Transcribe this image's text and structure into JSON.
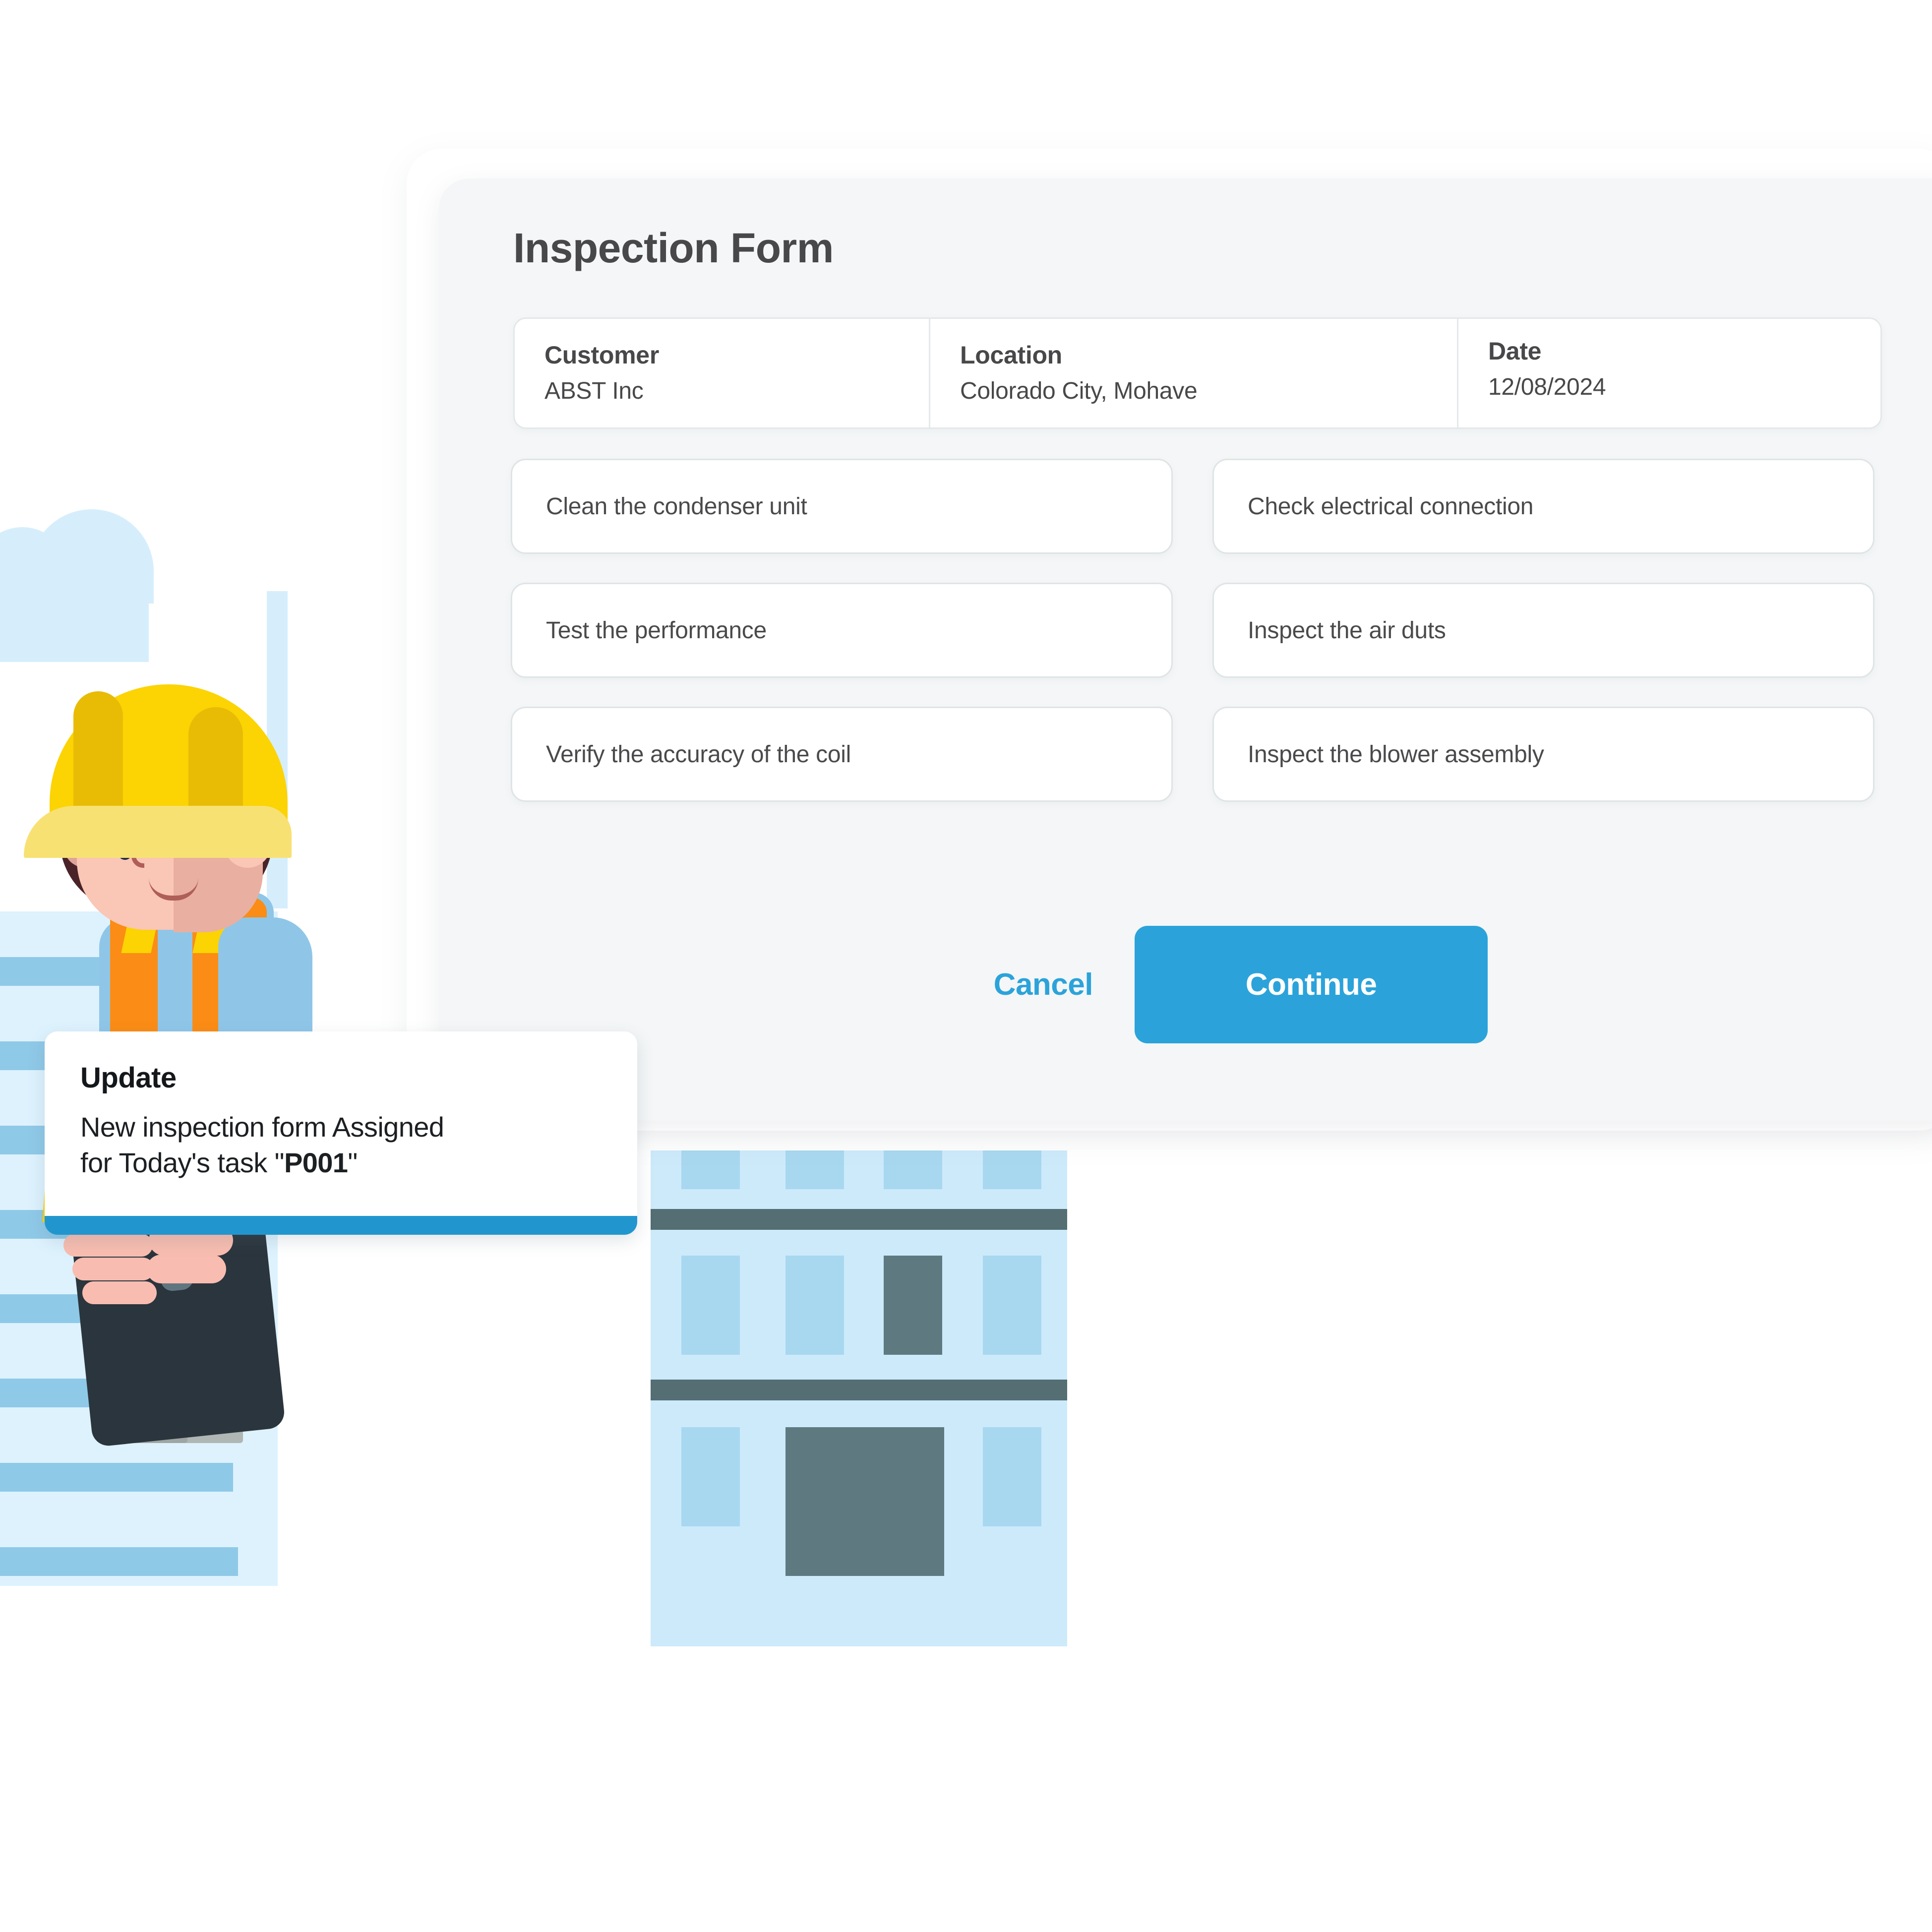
{
  "form": {
    "title": "Inspection Form",
    "meta": [
      {
        "label": "Customer",
        "value": "ABST Inc"
      },
      {
        "label": "Location",
        "value": "Colorado City, Mohave"
      },
      {
        "label": "Date",
        "value": "12/08/2024"
      }
    ],
    "tasks": [
      "Clean the condenser unit",
      "Check electrical connection",
      "Test the performance",
      "Inspect the air duts",
      "Verify the accuracy of the coil",
      "Inspect the blower assembly"
    ],
    "actions": {
      "cancel_label": "Cancel",
      "continue_label": "Continue"
    }
  },
  "notification": {
    "title": "Update",
    "line1": "New inspection form Assigned",
    "line2_prefix": "for Today's  task \"",
    "line2_code": "P001",
    "line2_suffix": "\""
  },
  "colors": {
    "accent": "#2BA3DA",
    "toast_bar": "#2196CE",
    "panel_bg": "#F4F6F7",
    "text": "#48484A",
    "field_border": "#DFE4E6",
    "helmet_yellow": "#FCD303",
    "vest_orange": "#FB8C15",
    "shirt_blue": "#8FC6E8",
    "building_blue": "#CDEAFB",
    "window_blue": "#A8D8F0",
    "band_slate": "#546E73",
    "skin": "#FAC6B5",
    "hair": "#4A2328",
    "tablet": "#2B353D"
  }
}
